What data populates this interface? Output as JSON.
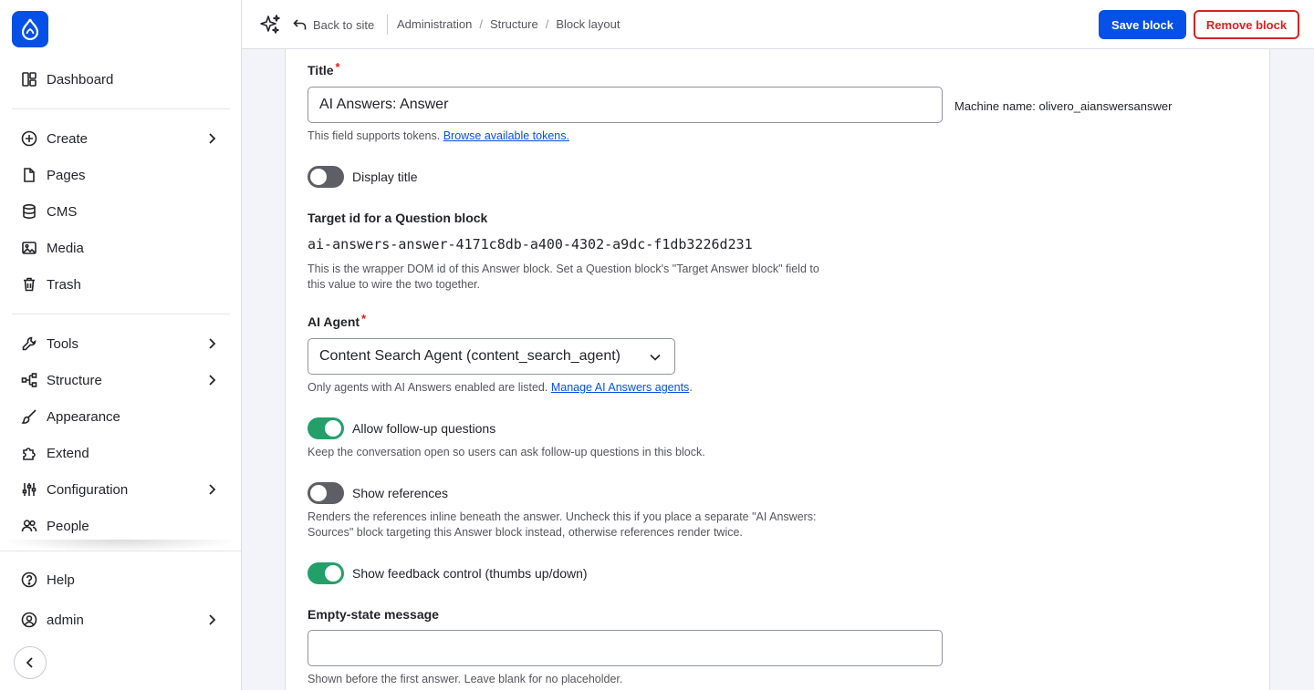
{
  "sidebar": {
    "logo_icon": "drupal-drop-icon",
    "items": [
      {
        "label": "Dashboard",
        "icon": "dashboard-icon"
      },
      {
        "label": "Create",
        "icon": "plus-circle-icon"
      },
      {
        "label": "Pages",
        "icon": "page-icon"
      },
      {
        "label": "CMS",
        "icon": "database-icon"
      },
      {
        "label": "Media",
        "icon": "image-icon"
      },
      {
        "label": "Trash",
        "icon": "trash-icon"
      },
      {
        "label": "Tools",
        "icon": "wrench-icon"
      },
      {
        "label": "Structure",
        "icon": "structure-icon"
      },
      {
        "label": "Appearance",
        "icon": "brush-icon"
      },
      {
        "label": "Extend",
        "icon": "puzzle-icon"
      },
      {
        "label": "Configuration",
        "icon": "sliders-icon"
      },
      {
        "label": "People",
        "icon": "people-icon"
      }
    ],
    "help_label": "Help",
    "user_label": "admin",
    "collapse_icon": "chevron-left-icon"
  },
  "topbar": {
    "back_label": "Back to site",
    "breadcrumbs": [
      "Administration",
      "Structure",
      "Block layout"
    ],
    "save_label": "Save block",
    "remove_label": "Remove block"
  },
  "form": {
    "title_label": "Title",
    "title_value": "AI Answers: Answer",
    "machine_name": "Machine name: olivero_aianswersanswer",
    "tokens_desc": "This field supports tokens.",
    "tokens_link": "Browse available tokens.",
    "display_title_label": "Display title",
    "display_title_on": false,
    "target_label": "Target id for a Question block",
    "target_value": "ai-answers-answer-4171c8db-a400-4302-a9dc-f1db3226d231",
    "target_desc_1": "This is the wrapper DOM id of this Answer block. Set a Question block's \"Target Answer block\" field to",
    "target_desc_2": "this value to wire the two together.",
    "agent_label": "AI Agent",
    "agent_value": "Content Search Agent (content_search_agent)",
    "agent_desc": "Only agents with AI Answers enabled are listed.",
    "agent_link": "Manage AI Answers agents",
    "followup_label": "Allow follow-up questions",
    "followup_on": true,
    "followup_desc": "Keep the conversation open so users can ask follow-up questions in this block.",
    "references_label": "Show references",
    "references_on": false,
    "references_desc_1": "Renders the references inline beneath the answer. Uncheck this if you place a separate \"AI Answers:",
    "references_desc_2": "Sources\" block targeting this Answer block instead, otherwise references render twice.",
    "feedback_label": "Show feedback control (thumbs up/down)",
    "feedback_on": true,
    "empty_label": "Empty-state message",
    "empty_value": "",
    "empty_desc": "Shown before the first answer. Leave blank for no placeholder."
  },
  "colors": {
    "brand": "#0550e6",
    "danger": "#d72222",
    "toggle_on": "#23a06a",
    "toggle_off": "#5e5f66"
  }
}
